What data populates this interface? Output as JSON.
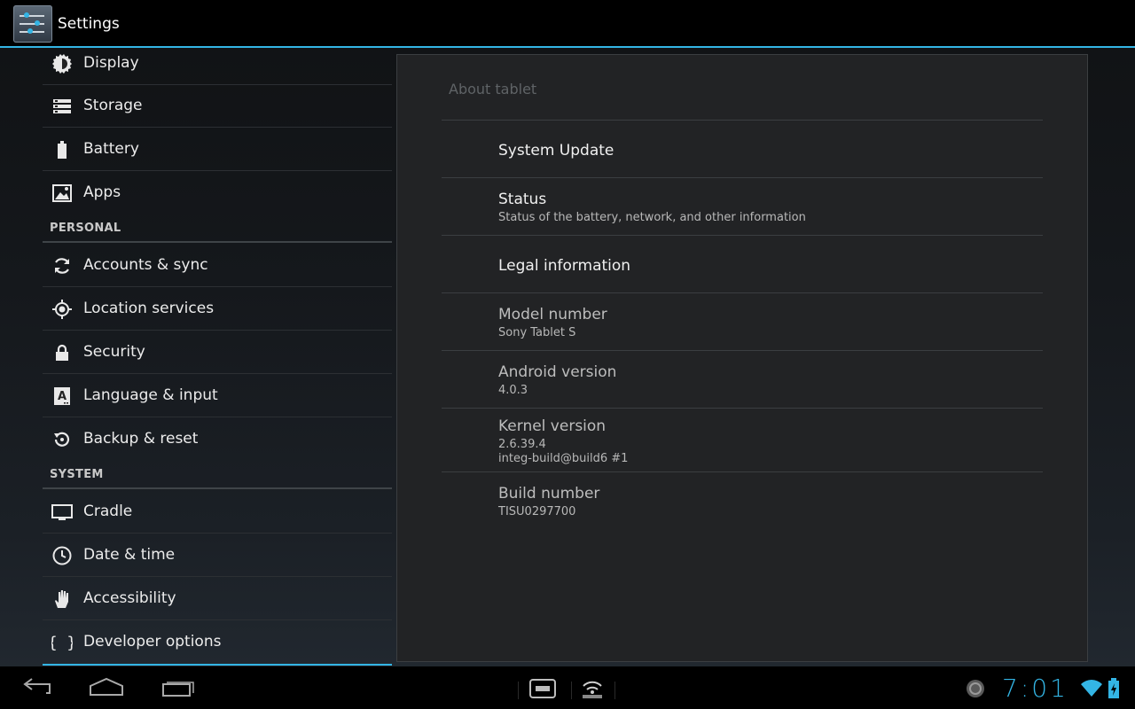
{
  "app": {
    "title": "Settings"
  },
  "sidebar": {
    "items": [
      {
        "label": "Display",
        "icon": "display-brightness-icon"
      },
      {
        "label": "Storage",
        "icon": "storage-icon"
      },
      {
        "label": "Battery",
        "icon": "battery-icon"
      },
      {
        "label": "Apps",
        "icon": "apps-icon"
      }
    ],
    "sections": [
      {
        "label": "PERSONAL",
        "items": [
          {
            "label": "Accounts & sync",
            "icon": "sync-icon"
          },
          {
            "label": "Location services",
            "icon": "location-icon"
          },
          {
            "label": "Security",
            "icon": "lock-icon"
          },
          {
            "label": "Language & input",
            "icon": "language-icon"
          },
          {
            "label": "Backup & reset",
            "icon": "backup-icon"
          }
        ]
      },
      {
        "label": "SYSTEM",
        "items": [
          {
            "label": "Cradle",
            "icon": "monitor-icon"
          },
          {
            "label": "Date & time",
            "icon": "clock-icon"
          },
          {
            "label": "Accessibility",
            "icon": "hand-icon"
          },
          {
            "label": "Developer options",
            "icon": "braces-icon"
          }
        ]
      }
    ]
  },
  "about": {
    "header": "About tablet",
    "items": [
      {
        "title": "System Update"
      },
      {
        "title": "Status",
        "summary": "Status of the battery, network, and other information"
      },
      {
        "title": "Legal information"
      },
      {
        "title": "Model number",
        "summary": "Sony Tablet S"
      },
      {
        "title": "Android version",
        "summary": "4.0.3"
      },
      {
        "title": "Kernel version",
        "summary": "2.6.39.4",
        "summary2": "integ-build@build6 #1"
      },
      {
        "title": "Build number",
        "summary": "TISU0297700"
      }
    ]
  },
  "status_bar": {
    "time": "7:01",
    "accent": "#33b5e5"
  }
}
